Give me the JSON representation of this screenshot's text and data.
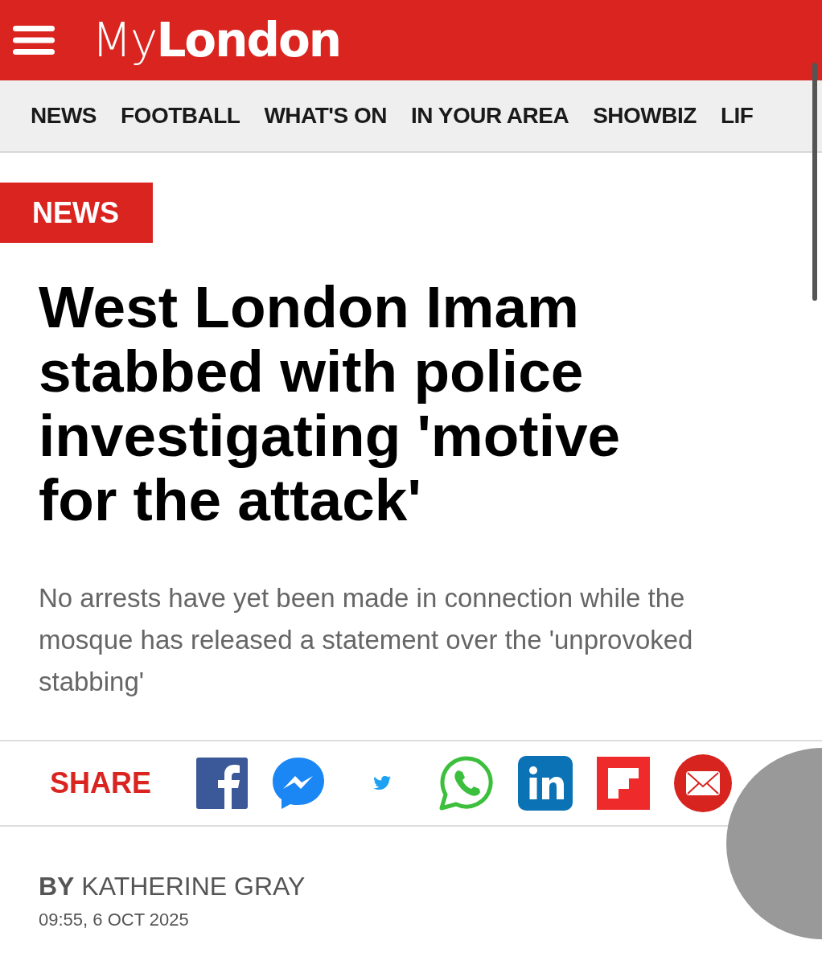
{
  "header": {
    "logo": "My**London**"
  },
  "nav": [
    "NEWS",
    "FOOTBALL",
    "WHAT'S ON",
    "IN YOUR AREA",
    "SHOWBIZ",
    "LIF"
  ],
  "article": {
    "section": "NEWS",
    "headline": "West London Imam stabbed with police investigating 'motive for the attack'",
    "standfirst": "No arrests have yet been made in connection while the mosque has released a statement over the 'unprovoked stabbing'"
  },
  "share": {
    "label": "SHARE",
    "icons": [
      {
        "kind": "facebook"
      },
      {
        "kind": "messenger"
      },
      {
        "kind": "twitter"
      },
      {
        "kind": "whatsapp"
      },
      {
        "kind": "linkedin"
      },
      {
        "kind": "flipboard"
      },
      {
        "kind": "email"
      }
    ]
  },
  "byline": {
    "author": "**BY** KATHERINE GRAY",
    "date": "09:55, 6 OCT 2025"
  }
}
